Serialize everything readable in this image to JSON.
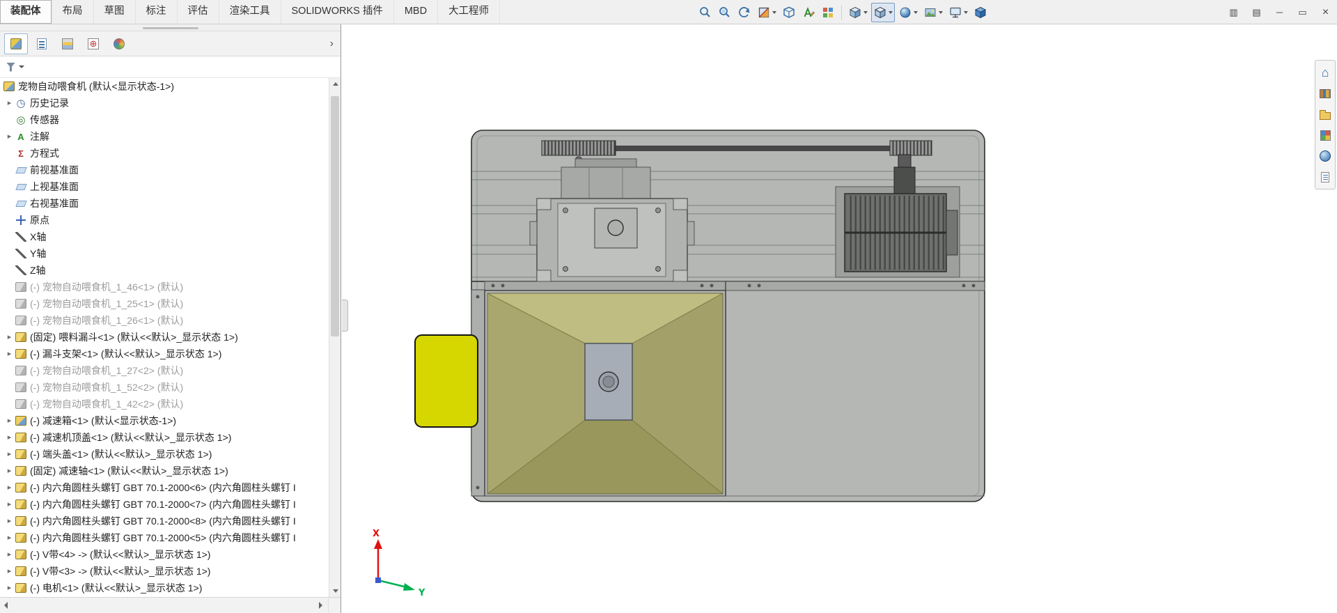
{
  "menubar": {
    "tabs": [
      "装配体",
      "布局",
      "草图",
      "标注",
      "评估",
      "渲染工具",
      "SOLIDWORKS 插件",
      "MBD",
      "大工程师"
    ],
    "active_tab": "装配体"
  },
  "headsup": {
    "icons": [
      "zoom-to-fit",
      "zoom-to-area",
      "previous-view",
      "section-view",
      "3d-drawing-view",
      "annotation-view",
      "appearance-pattern",
      "display-style",
      "view-orientation",
      "edit-appearance",
      "apply-scene",
      "view-settings",
      "realview"
    ]
  },
  "window_controls": [
    {
      "name": "toggle-left-pane-icon",
      "glyph": "▥"
    },
    {
      "name": "toggle-right-pane-icon",
      "glyph": "▤"
    },
    {
      "name": "minimize-icon",
      "glyph": "─"
    },
    {
      "name": "restore-icon",
      "glyph": "▭"
    },
    {
      "name": "close-icon",
      "glyph": "×"
    }
  ],
  "panel": {
    "tabs": [
      "featuremanager-design-tree",
      "propertymanager",
      "configurationmanager",
      "dimxpertmanager",
      "displaymanager"
    ]
  },
  "tree": {
    "items": [
      {
        "label": "宠物自动喂食机 (默认<显示状态-1>)",
        "icon": "assembly"
      },
      {
        "label": "历史记录",
        "icon": "history",
        "expandable": true
      },
      {
        "label": "传感器",
        "icon": "sensors"
      },
      {
        "label": "注解",
        "icon": "annotations",
        "expandable": true
      },
      {
        "label": "方程式",
        "icon": "equations"
      },
      {
        "label": "前视基准面",
        "icon": "plane"
      },
      {
        "label": "上视基准面",
        "icon": "plane"
      },
      {
        "label": "右视基准面",
        "icon": "plane"
      },
      {
        "label": "原点",
        "icon": "origin"
      },
      {
        "label": "X轴",
        "icon": "axis"
      },
      {
        "label": "Y轴",
        "icon": "axis"
      },
      {
        "label": "Z轴",
        "icon": "axis"
      },
      {
        "label": "(-) 宠物自动喂食机_1_46<1> (默认)",
        "icon": "component",
        "suppressed": true
      },
      {
        "label": "(-) 宠物自动喂食机_1_25<1> (默认)",
        "icon": "component",
        "suppressed": true
      },
      {
        "label": "(-) 宠物自动喂食机_1_26<1> (默认)",
        "icon": "component",
        "suppressed": true
      },
      {
        "label": "(固定) 喂料漏斗<1> (默认<<默认>_显示状态 1>)",
        "icon": "part",
        "expandable": true
      },
      {
        "label": "(-) 漏斗支架<1> (默认<<默认>_显示状态 1>)",
        "icon": "part",
        "expandable": true
      },
      {
        "label": "(-) 宠物自动喂食机_1_27<2> (默认)",
        "icon": "component",
        "suppressed": true
      },
      {
        "label": "(-) 宠物自动喂食机_1_52<2> (默认)",
        "icon": "component",
        "suppressed": true
      },
      {
        "label": "(-) 宠物自动喂食机_1_42<2> (默认)",
        "icon": "component",
        "suppressed": true
      },
      {
        "label": "(-) 减速箱<1> (默认<显示状态-1>)",
        "icon": "assembly",
        "expandable": true
      },
      {
        "label": "(-) 减速机顶盖<1> (默认<<默认>_显示状态 1>)",
        "icon": "part",
        "expandable": true
      },
      {
        "label": "(-) 端头盖<1> (默认<<默认>_显示状态 1>)",
        "icon": "part",
        "expandable": true
      },
      {
        "label": "(固定) 减速轴<1> (默认<<默认>_显示状态 1>)",
        "icon": "part",
        "expandable": true
      },
      {
        "label": "(-) 内六角圆柱头螺钉 GBT 70.1-2000<6> (内六角圆柱头螺钉 I",
        "icon": "part",
        "expandable": true
      },
      {
        "label": "(-) 内六角圆柱头螺钉 GBT 70.1-2000<7> (内六角圆柱头螺钉 I",
        "icon": "part",
        "expandable": true
      },
      {
        "label": "(-) 内六角圆柱头螺钉 GBT 70.1-2000<8> (内六角圆柱头螺钉 I",
        "icon": "part",
        "expandable": true
      },
      {
        "label": "(-) 内六角圆柱头螺钉 GBT 70.1-2000<5> (内六角圆柱头螺钉 I",
        "icon": "part",
        "expandable": true
      },
      {
        "label": "(-) V带<4> -> (默认<<默认>_显示状态 1>)",
        "icon": "part",
        "expandable": true
      },
      {
        "label": "(-) V带<3> -> (默认<<默认>_显示状态 1>)",
        "icon": "part",
        "expandable": true
      },
      {
        "label": "(-) 电机<1> (默认<<默认>_显示状态 1>)",
        "icon": "part",
        "expandable": true
      }
    ]
  },
  "taskpane": {
    "icons": [
      "solidworks-resources",
      "design-library",
      "file-explorer",
      "view-palette",
      "appearances-scenes",
      "custom-properties"
    ]
  },
  "viewport": {
    "triad": {
      "x_label": "X",
      "y_label": "Y"
    }
  },
  "colors": {
    "machine_gray": "#b4b7b4",
    "yellow_part": "#d6d600",
    "funnel_top": "#bfbd82",
    "funnel_left": "#a9a76d",
    "funnel_right": "#a3a169",
    "funnel_bottom": "#99975c",
    "funnel_inner": "#a7adb6",
    "triad_x": "#e01010",
    "triad_y": "#00b050"
  }
}
